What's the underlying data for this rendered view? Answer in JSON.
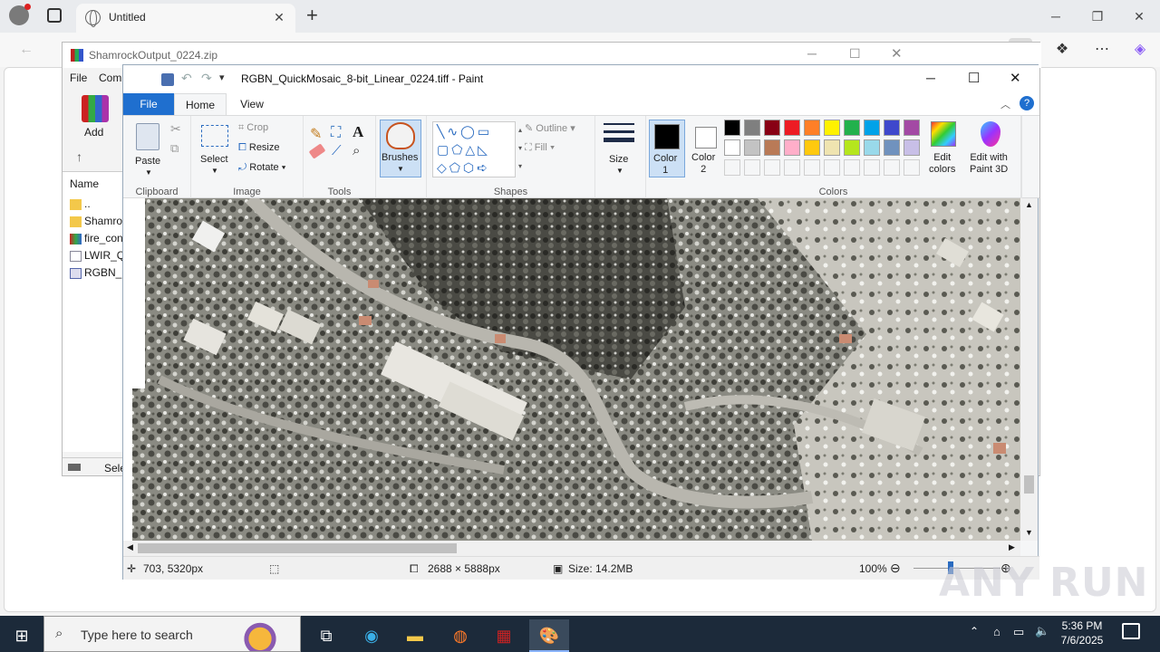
{
  "browser": {
    "tab_title": "Untitled",
    "new_tab": "+",
    "close_tab": "✕"
  },
  "winrar": {
    "title": "ShamrockOutput_0224.zip",
    "menu_file": "File",
    "menu_commands": "Com",
    "add_label": "Add",
    "name_header": "Name",
    "files": [
      "..",
      "Shamro",
      "fire_con",
      "LWIR_Q",
      "RGBN_C"
    ],
    "status_text": "Sele"
  },
  "paint": {
    "title": "RGBN_QuickMosaic_8-bit_Linear_0224.tiff - Paint",
    "tabs": {
      "file": "File",
      "home": "Home",
      "view": "View"
    },
    "clipboard": {
      "paste": "Paste",
      "label": "Clipboard"
    },
    "image": {
      "select": "Select",
      "crop": "Crop",
      "resize": "Resize",
      "rotate": "Rotate",
      "label": "Image"
    },
    "tools": {
      "label": "Tools"
    },
    "brushes": "Brushes",
    "shapes": {
      "outline": "Outline",
      "fill": "Fill",
      "label": "Shapes"
    },
    "size": "Size",
    "color1": "Color\n1",
    "color1_a": "Color",
    "color1_b": "1",
    "color2_a": "Color",
    "color2_b": "2",
    "colors_label": "Colors",
    "edit_colors_a": "Edit",
    "edit_colors_b": "colors",
    "paint3d_a": "Edit with",
    "paint3d_b": "Paint 3D",
    "palette": [
      "#000000",
      "#7f7f7f",
      "#880015",
      "#ed1c24",
      "#ff7f27",
      "#fff200",
      "#22b14c",
      "#00a2e8",
      "#3f48cc",
      "#a349a4",
      "#ffffff",
      "#c3c3c3",
      "#b97a57",
      "#ffaec9",
      "#ffc90e",
      "#efe4b0",
      "#b5e61d",
      "#99d9ea",
      "#7092be",
      "#c8bfe7"
    ],
    "status": {
      "cursor": "703, 5320px",
      "dimensions": "2688 × 5888px",
      "size": "Size: 14.2MB",
      "zoom": "100%"
    }
  },
  "taskbar": {
    "search_placeholder": "Type here to search",
    "time": "5:36 PM",
    "date": "7/6/2025"
  },
  "watermark": "ANY RUN"
}
